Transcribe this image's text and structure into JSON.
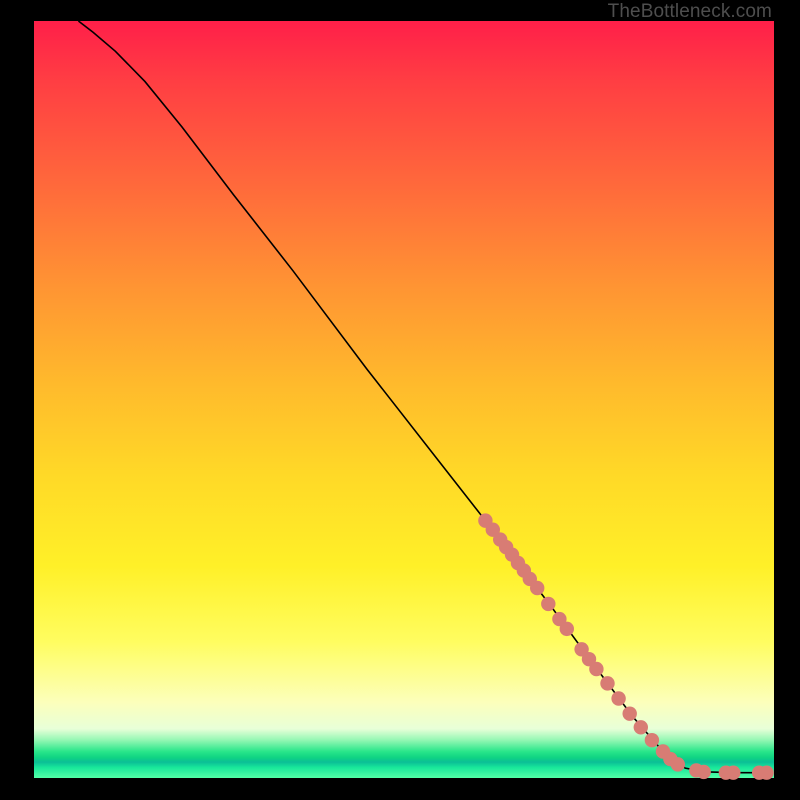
{
  "watermark": "TheBottleneck.com",
  "colors": {
    "curve_stroke": "#000000",
    "dot_fill": "#d87c74",
    "dot_stroke": "#b85f59"
  },
  "chart_data": {
    "type": "line",
    "title": "",
    "xlabel": "",
    "ylabel": "",
    "xlim": [
      0,
      100
    ],
    "ylim": [
      0,
      100
    ],
    "curve": [
      {
        "x": 6.0,
        "y": 100.0
      },
      {
        "x": 8.0,
        "y": 98.5
      },
      {
        "x": 11.0,
        "y": 96.0
      },
      {
        "x": 15.0,
        "y": 92.0
      },
      {
        "x": 20.0,
        "y": 86.0
      },
      {
        "x": 27.0,
        "y": 77.0
      },
      {
        "x": 35.0,
        "y": 67.0
      },
      {
        "x": 45.0,
        "y": 54.0
      },
      {
        "x": 55.0,
        "y": 41.5
      },
      {
        "x": 63.0,
        "y": 31.5
      },
      {
        "x": 70.0,
        "y": 22.5
      },
      {
        "x": 76.0,
        "y": 14.5
      },
      {
        "x": 81.0,
        "y": 8.0
      },
      {
        "x": 85.0,
        "y": 3.5
      },
      {
        "x": 88.0,
        "y": 1.3
      },
      {
        "x": 91.0,
        "y": 0.8
      },
      {
        "x": 95.0,
        "y": 0.7
      },
      {
        "x": 99.0,
        "y": 0.7
      }
    ],
    "dots": [
      {
        "x": 61.0,
        "y": 34.0
      },
      {
        "x": 62.0,
        "y": 32.8
      },
      {
        "x": 63.0,
        "y": 31.5
      },
      {
        "x": 63.8,
        "y": 30.5
      },
      {
        "x": 64.6,
        "y": 29.5
      },
      {
        "x": 65.4,
        "y": 28.4
      },
      {
        "x": 66.2,
        "y": 27.4
      },
      {
        "x": 67.0,
        "y": 26.3
      },
      {
        "x": 68.0,
        "y": 25.1
      },
      {
        "x": 69.5,
        "y": 23.0
      },
      {
        "x": 71.0,
        "y": 21.0
      },
      {
        "x": 72.0,
        "y": 19.7
      },
      {
        "x": 74.0,
        "y": 17.0
      },
      {
        "x": 75.0,
        "y": 15.7
      },
      {
        "x": 76.0,
        "y": 14.4
      },
      {
        "x": 77.5,
        "y": 12.5
      },
      {
        "x": 79.0,
        "y": 10.5
      },
      {
        "x": 80.5,
        "y": 8.5
      },
      {
        "x": 82.0,
        "y": 6.7
      },
      {
        "x": 83.5,
        "y": 5.0
      },
      {
        "x": 85.0,
        "y": 3.5
      },
      {
        "x": 86.0,
        "y": 2.5
      },
      {
        "x": 87.0,
        "y": 1.8
      },
      {
        "x": 89.5,
        "y": 1.0
      },
      {
        "x": 90.5,
        "y": 0.8
      },
      {
        "x": 93.5,
        "y": 0.7
      },
      {
        "x": 94.5,
        "y": 0.7
      },
      {
        "x": 98.0,
        "y": 0.7
      },
      {
        "x": 99.0,
        "y": 0.7
      }
    ]
  }
}
